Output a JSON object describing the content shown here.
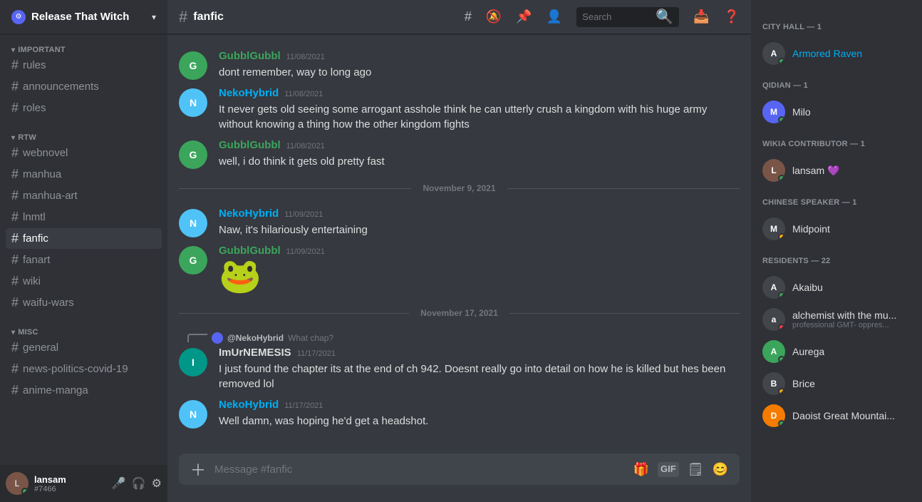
{
  "server": {
    "name": "Release That Witch",
    "icon_text": "R"
  },
  "sidebar": {
    "sections": [
      {
        "label": "IMPORTANT",
        "items": [
          {
            "name": "rules",
            "label": "rules"
          },
          {
            "name": "announcements",
            "label": "announcements"
          },
          {
            "name": "roles",
            "label": "roles"
          }
        ]
      },
      {
        "label": "RTW",
        "items": [
          {
            "name": "webnovel",
            "label": "webnovel"
          },
          {
            "name": "manhua",
            "label": "manhua"
          },
          {
            "name": "manhua-art",
            "label": "manhua-art"
          },
          {
            "name": "lnmtl",
            "label": "lnmtl"
          },
          {
            "name": "fanfic",
            "label": "fanfic",
            "active": true
          },
          {
            "name": "fanart",
            "label": "fanart"
          },
          {
            "name": "wiki",
            "label": "wiki"
          },
          {
            "name": "waifu-wars",
            "label": "waifu-wars"
          }
        ]
      },
      {
        "label": "MISC",
        "items": [
          {
            "name": "general",
            "label": "general"
          },
          {
            "name": "news-politics-covid-19",
            "label": "news-politics-covid-19"
          },
          {
            "name": "anime-manga",
            "label": "anime-manga"
          }
        ]
      }
    ]
  },
  "user_panel": {
    "name": "lansam",
    "discriminator": "#7466",
    "status": "online"
  },
  "channel_header": {
    "name": "fanfic",
    "search_placeholder": "Search"
  },
  "messages": [
    {
      "id": "msg1",
      "author": "GubblGubbl",
      "author_color": "green",
      "timestamp": "11/08/2021",
      "text": "dont remember, way to long ago",
      "avatar_color": "av-green",
      "avatar_text": "G"
    },
    {
      "id": "msg2",
      "author": "NekoHybrid",
      "author_color": "blue",
      "timestamp": "11/08/2021",
      "text": "It never gets old seeing some arrogant asshole think he can utterly crush a kingdom with his huge army without knowing a thing how the other kingdom fights",
      "avatar_color": "av-blue",
      "avatar_text": "N"
    },
    {
      "id": "msg3",
      "author": "GubblGubbl",
      "author_color": "green",
      "timestamp": "11/08/2021",
      "text": "well, i do think it gets old pretty fast",
      "avatar_color": "av-green",
      "avatar_text": "G"
    },
    {
      "id": "divider1",
      "type": "date",
      "label": "November 9, 2021"
    },
    {
      "id": "msg4",
      "author": "NekoHybrid",
      "author_color": "blue",
      "timestamp": "11/09/2021",
      "text": "Naw, it's hilariously entertaining",
      "avatar_color": "av-blue",
      "avatar_text": "N"
    },
    {
      "id": "msg5",
      "author": "GubblGubbl",
      "author_color": "green",
      "timestamp": "11/09/2021",
      "text": "",
      "emoji": "🐸",
      "avatar_color": "av-green",
      "avatar_text": "G"
    },
    {
      "id": "divider2",
      "type": "date",
      "label": "November 17, 2021"
    },
    {
      "id": "msg6",
      "author": "ImUrNEMESIS",
      "author_color": "normal",
      "timestamp": "11/17/2021",
      "has_reply": true,
      "reply_author": "@NekoHybrid",
      "reply_text": "What chap?",
      "text": "I just found the chapter its at the end of ch 942. Doesnt really go into detail on how he is killed but hes been removed lol",
      "avatar_color": "av-teal",
      "avatar_text": "I"
    },
    {
      "id": "msg7",
      "author": "NekoHybrid",
      "author_color": "blue",
      "timestamp": "11/17/2021",
      "text": "Well damn, was hoping he'd get a headshot.",
      "avatar_color": "av-blue",
      "avatar_text": "N"
    }
  ],
  "message_input": {
    "placeholder": "Message #fanfic"
  },
  "members": {
    "sections": [
      {
        "label": "CITY HALL — 1",
        "members": [
          {
            "name": "Armored Raven",
            "status": "online",
            "color": "av-dark",
            "text": "A",
            "name_color": "link"
          }
        ]
      },
      {
        "label": "QIDIAN — 1",
        "members": [
          {
            "name": "Milo",
            "status": "online",
            "color": "av-purple",
            "text": "M"
          }
        ]
      },
      {
        "label": "WIKIA CONTRIBUTOR — 1",
        "members": [
          {
            "name": "lansam",
            "status": "online",
            "color": "av-brown",
            "text": "L",
            "has_nitro": true
          }
        ]
      },
      {
        "label": "CHINESE SPEAKER — 1",
        "members": [
          {
            "name": "Midpoint",
            "status": "idle",
            "color": "av-dark",
            "text": "M"
          }
        ]
      },
      {
        "label": "RESIDENTS — 22",
        "members": [
          {
            "name": "Akaibu",
            "status": "online",
            "color": "av-dark",
            "text": "A"
          },
          {
            "name": "alchemist with the mu...",
            "sub": "professional GMT- oppres...",
            "status": "dnd",
            "color": "av-dark",
            "text": "a"
          },
          {
            "name": "Aurega",
            "status": "online",
            "color": "av-green",
            "text": "A"
          },
          {
            "name": "Brice",
            "status": "idle",
            "color": "av-dark",
            "text": "B"
          },
          {
            "name": "Daoist Great Mountai...",
            "status": "online",
            "color": "av-orange",
            "text": "D"
          }
        ]
      }
    ]
  }
}
